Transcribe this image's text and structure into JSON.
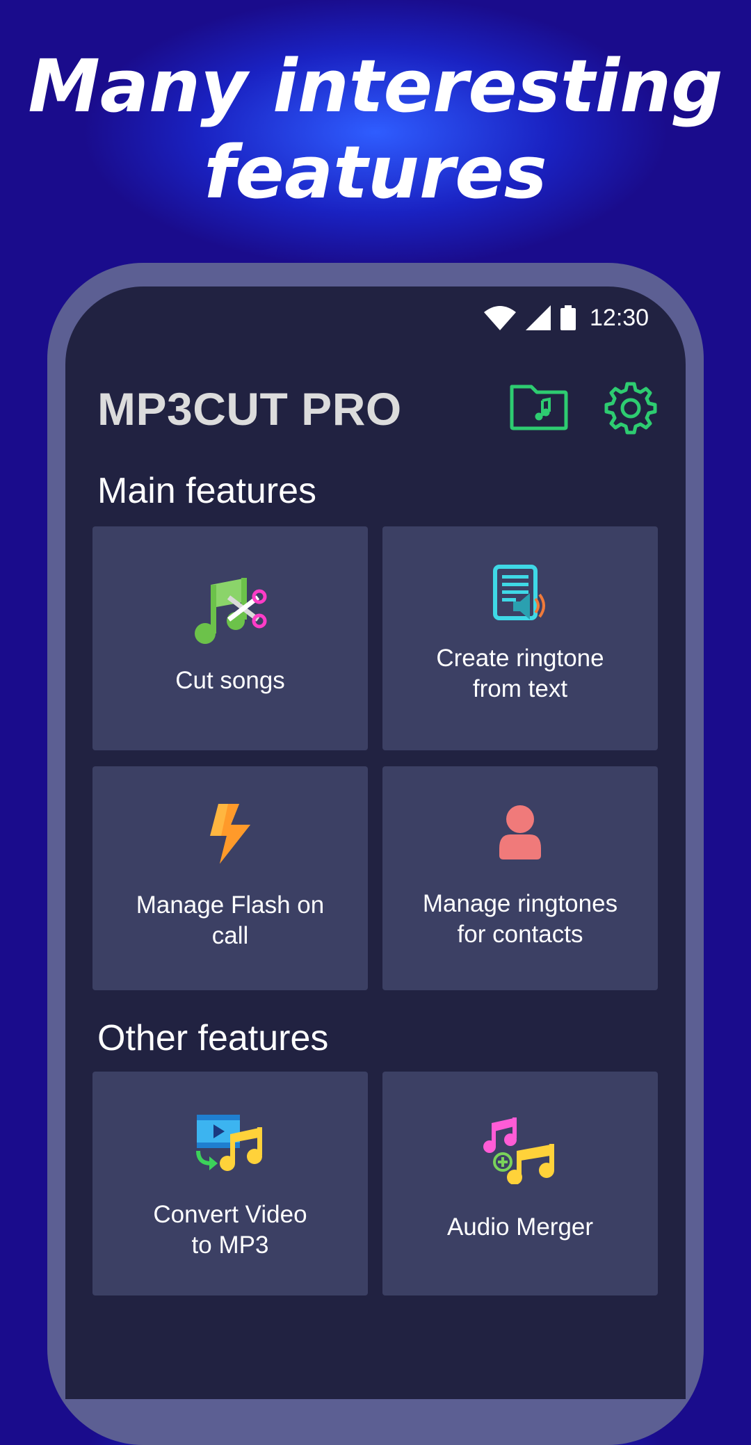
{
  "headline": {
    "line1": "Many interesting",
    "line2": "features"
  },
  "status_bar": {
    "time": "12:30"
  },
  "app": {
    "title": "MP3CUT PRO"
  },
  "sections": {
    "main_title": "Main features",
    "other_title": "Other features"
  },
  "main_features": [
    {
      "label": "Cut songs",
      "icon": "music-scissors-icon"
    },
    {
      "label": "Create ringtone\nfrom text",
      "icon": "text-to-speech-icon"
    },
    {
      "label": "Manage Flash on\ncall",
      "icon": "lightning-icon"
    },
    {
      "label": "Manage ringtones\nfor contacts",
      "icon": "contact-person-icon"
    }
  ],
  "other_features": [
    {
      "label": "Convert Video\nto MP3",
      "icon": "video-to-music-icon"
    },
    {
      "label": "Audio Merger",
      "icon": "music-merge-icon"
    }
  ],
  "colors": {
    "accent_green": "#2ecc71",
    "card_bg": "#3c4064",
    "screen_bg": "#212241",
    "frame": "#5c5f93"
  }
}
